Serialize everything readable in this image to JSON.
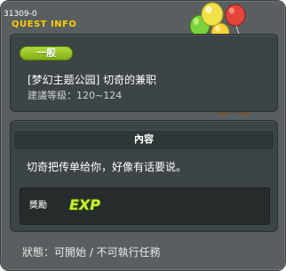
{
  "window": {
    "quest_id": "31309-0",
    "title": "QUEST INFO"
  },
  "summary": {
    "category": "一般",
    "quest_name": "[梦幻主题公园] 切奇的兼职",
    "level_requirement": "建議等級：120~124"
  },
  "content": {
    "header": "內容",
    "description": "切奇把传单给你，好像有话要说。"
  },
  "reward": {
    "label": "獎勵",
    "type_badge": "EXP"
  },
  "status": "狀態：可開始 / 不可執行任務",
  "mascot": {
    "icon": "bear-with-balloons-icon",
    "balloon_colors": [
      "#f7d33a",
      "#e3453a",
      "#7bd23c",
      "#c6e36a"
    ]
  },
  "colors": {
    "title_accent": "#ffcc00",
    "badge_green": "#9bc822",
    "exp_green": "#c8f03a"
  }
}
